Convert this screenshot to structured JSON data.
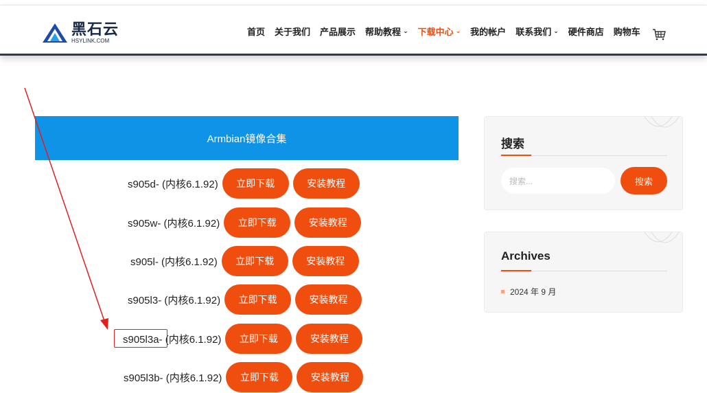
{
  "logo": {
    "cn": "黑石云",
    "en": "HSYLINK.COM"
  },
  "nav": [
    {
      "label": "首页",
      "caret": false,
      "active": false
    },
    {
      "label": "关于我们",
      "caret": false,
      "active": false
    },
    {
      "label": "产品展示",
      "caret": false,
      "active": false
    },
    {
      "label": "帮助教程",
      "caret": true,
      "active": false
    },
    {
      "label": "下载中心",
      "caret": true,
      "active": true
    },
    {
      "label": "我的帐户",
      "caret": false,
      "active": false
    },
    {
      "label": "联系我们",
      "caret": true,
      "active": false
    },
    {
      "label": "硬件商店",
      "caret": false,
      "active": false
    },
    {
      "label": "购物车",
      "caret": false,
      "active": false
    }
  ],
  "banner": {
    "title": "Armbian镜像合集"
  },
  "downloads": [
    {
      "label": "s905d- (内核6.1.92)",
      "download": "立即下载",
      "tutorial": "安装教程"
    },
    {
      "label": "s905w- (内核6.1.92)",
      "download": "立即下载",
      "tutorial": "安装教程"
    },
    {
      "label": "s905l- (内核6.1.92)",
      "download": "立即下载",
      "tutorial": "安装教程"
    },
    {
      "label": "s905l3- (内核6.1.92)",
      "download": "立即下载",
      "tutorial": "安装教程"
    },
    {
      "label": "s905l3a- (内核6.1.92)",
      "download": "立即下载",
      "tutorial": "安装教程"
    },
    {
      "label": "s905l3b- (内核6.1.92)",
      "download": "立即下载",
      "tutorial": "安装教程"
    }
  ],
  "search_widget": {
    "title": "搜索",
    "placeholder": "搜索...",
    "button": "搜索"
  },
  "archives_widget": {
    "title": "Archives",
    "items": [
      "2024 年 9 月"
    ]
  },
  "colors": {
    "accent": "#f04e0f",
    "banner": "#0e93e6",
    "annotation": "#e02020"
  }
}
